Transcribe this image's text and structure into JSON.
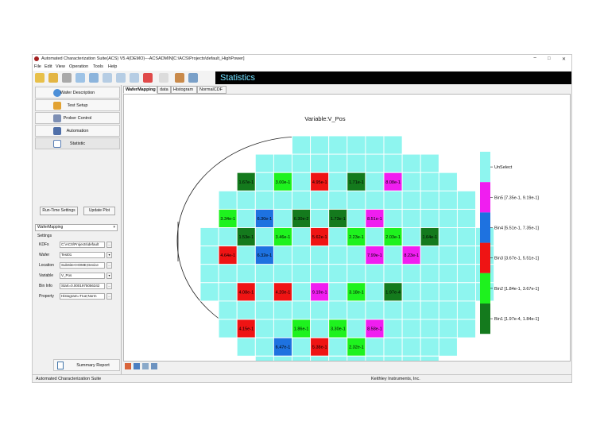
{
  "window": {
    "title": "Automated Characterization Suite(ACS) V5.4(DEMO)---ACSADMIN[C:\\ACS\\Projects\\default_HighPower]",
    "minimize": "−",
    "maximize": "□",
    "close": "✕"
  },
  "menu": [
    "File",
    "Edit",
    "View",
    "Operation",
    "Tools",
    "Help"
  ],
  "toolbar": {
    "icons": [
      "wand-icon",
      "open-icon",
      "save-icon",
      "print-icon",
      "play-icon",
      "play-outline-icon",
      "step-icon",
      "pause-icon",
      "stop-icon",
      "cancel-icon",
      "chart-icon",
      "refresh-icon"
    ],
    "statistics_title": "Statistics"
  },
  "nav": [
    {
      "label": "Wafer Description",
      "icon": "wafer-icon"
    },
    {
      "label": "Test Setup",
      "icon": "gear-icon"
    },
    {
      "label": "Prober Control",
      "icon": "prober-icon"
    },
    {
      "label": "Automation",
      "icon": "automation-icon"
    },
    {
      "label": "Statistic",
      "icon": "statistic-icon"
    }
  ],
  "buttons": {
    "run_time_settings": "Run-Time Settings",
    "update_plot": "Update Plot",
    "summary_report": "Summary Report"
  },
  "wafer_mapping_select": "WaferMapping",
  "settings_label": "Settings",
  "properties": [
    {
      "label": "KDFs",
      "value": "C:\\ACS\\Projects\\default"
    },
    {
      "label": "Wafer",
      "value": "Test01"
    },
    {
      "label": "Location",
      "value": "SubSite<HOME;Device"
    },
    {
      "label": "Variable",
      "value": "V_Pos"
    },
    {
      "label": "Bin Info",
      "value": "Start=0.0001975056342"
    },
    {
      "label": "Property",
      "value": "Histogram=True;Norm"
    }
  ],
  "tabs": [
    "WaferMapping",
    "data",
    "Histogram",
    "NormalCDF"
  ],
  "status": {
    "left": "Automated Characterization Suite",
    "right": "Keithley Instruments, Inc."
  },
  "colors": {
    "unselect": "#8ef5ef",
    "bin1": "#147a1d",
    "bin2": "#1ef21e",
    "bin3": "#ef1414",
    "bin4": "#1e72e0",
    "bin5": "#f01ef0"
  },
  "chart_data": {
    "type": "heatmap",
    "title": "Variable:V_Pos",
    "legend": [
      {
        "key": "unselect",
        "label": "UnSelect"
      },
      {
        "key": "bin5",
        "label": "Bin5 [7.35e-1, 9.19e-1]"
      },
      {
        "key": "bin4",
        "label": "Bin4 [5.51e-1, 7.35e-1]"
      },
      {
        "key": "bin3",
        "label": "Bin3 [3.67e-1, 5.51e-1]"
      },
      {
        "key": "bin2",
        "label": "Bin2 [1.84e-1, 3.67e-1]"
      },
      {
        "key": "bin1",
        "label": "Bin1 [1.97e-4, 1.84e-1]"
      }
    ],
    "rows": [
      {
        "row": 0,
        "cols": [
          5,
          10
        ]
      },
      {
        "row": 1,
        "cols": [
          3,
          12
        ]
      },
      {
        "row": 2,
        "cols": [
          2,
          13
        ]
      },
      {
        "row": 3,
        "cols": [
          1,
          14
        ]
      },
      {
        "row": 4,
        "cols": [
          1,
          14
        ]
      },
      {
        "row": 5,
        "cols": [
          0,
          15
        ]
      },
      {
        "row": 6,
        "cols": [
          0,
          15
        ]
      },
      {
        "row": 7,
        "cols": [
          0,
          15
        ]
      },
      {
        "row": 8,
        "cols": [
          0,
          15
        ]
      },
      {
        "row": 9,
        "cols": [
          1,
          14
        ]
      },
      {
        "row": 10,
        "cols": [
          1,
          14
        ]
      },
      {
        "row": 11,
        "cols": [
          2,
          13
        ]
      },
      {
        "row": 12,
        "cols": [
          3,
          12
        ]
      },
      {
        "row": 13,
        "cols": [
          6,
          9
        ]
      }
    ],
    "sites": [
      {
        "row": 2,
        "col": 2,
        "bin": "bin1",
        "label": "1.67e-1"
      },
      {
        "row": 2,
        "col": 4,
        "bin": "bin2",
        "label": "3.00e-1"
      },
      {
        "row": 2,
        "col": 6,
        "bin": "bin3",
        "label": "4.95e-1"
      },
      {
        "row": 2,
        "col": 8,
        "bin": "bin1",
        "label": "1.71e-1"
      },
      {
        "row": 2,
        "col": 10,
        "bin": "bin5",
        "label": "8.08e-1"
      },
      {
        "row": 4,
        "col": 1,
        "bin": "bin2",
        "label": "3.34e-1"
      },
      {
        "row": 4,
        "col": 3,
        "bin": "bin4",
        "label": "6.30e-1"
      },
      {
        "row": 4,
        "col": 5,
        "bin": "bin1",
        "label": "6.30e-2"
      },
      {
        "row": 4,
        "col": 7,
        "bin": "bin1",
        "label": "1.73e-1"
      },
      {
        "row": 4,
        "col": 9,
        "bin": "bin5",
        "label": "8.51e-1"
      },
      {
        "row": 5,
        "col": 2,
        "bin": "bin1",
        "label": "1.53e-1"
      },
      {
        "row": 5,
        "col": 4,
        "bin": "bin2",
        "label": "3.46e-1"
      },
      {
        "row": 5,
        "col": 6,
        "bin": "bin3",
        "label": "5.62e-1"
      },
      {
        "row": 5,
        "col": 8,
        "bin": "bin2",
        "label": "2.23e-1"
      },
      {
        "row": 5,
        "col": 10,
        "bin": "bin2",
        "label": "2.03e-1"
      },
      {
        "row": 5,
        "col": 12,
        "bin": "bin1",
        "label": "1.64e-1"
      },
      {
        "row": 6,
        "col": 1,
        "bin": "bin3",
        "label": "4.64e-1"
      },
      {
        "row": 6,
        "col": 3,
        "bin": "bin4",
        "label": "6.32e-1"
      },
      {
        "row": 6,
        "col": 9,
        "bin": "bin5",
        "label": "7.99e-1"
      },
      {
        "row": 6,
        "col": 11,
        "bin": "bin5",
        "label": "8.23e-1"
      },
      {
        "row": 8,
        "col": 2,
        "bin": "bin3",
        "label": "4.08e-1"
      },
      {
        "row": 8,
        "col": 4,
        "bin": "bin3",
        "label": "4.20e-1"
      },
      {
        "row": 8,
        "col": 6,
        "bin": "bin5",
        "label": "9.19e-1"
      },
      {
        "row": 8,
        "col": 8,
        "bin": "bin2",
        "label": "3.18e-1"
      },
      {
        "row": 8,
        "col": 10,
        "bin": "bin1",
        "label": "1.97e-4"
      },
      {
        "row": 10,
        "col": 2,
        "bin": "bin3",
        "label": "4.15e-1"
      },
      {
        "row": 10,
        "col": 5,
        "bin": "bin2",
        "label": "1.86e-1"
      },
      {
        "row": 10,
        "col": 7,
        "bin": "bin2",
        "label": "3.30e-1"
      },
      {
        "row": 10,
        "col": 9,
        "bin": "bin5",
        "label": "8.58e-1"
      },
      {
        "row": 11,
        "col": 4,
        "bin": "bin4",
        "label": "6.47e-1"
      },
      {
        "row": 11,
        "col": 6,
        "bin": "bin3",
        "label": "5.38e-1"
      },
      {
        "row": 11,
        "col": 8,
        "bin": "bin2",
        "label": "2.32e-1"
      }
    ]
  }
}
